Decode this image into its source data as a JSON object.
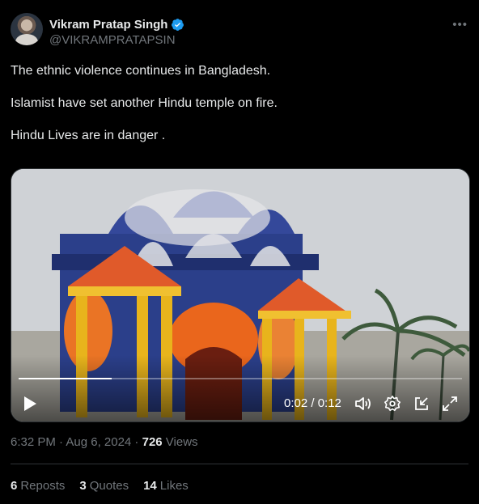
{
  "author": {
    "name": "Vikram Pratap Singh",
    "handle": "@VIKRAMPRATAPSIN",
    "verified": true
  },
  "more_icon": "ellipsis-icon",
  "post": {
    "lines": [
      "The ethnic violence continues in Bangladesh.",
      "Islamist have set another Hindu temple on fire.",
      "Hindu Lives are in danger ."
    ]
  },
  "video": {
    "time_display": "0:02 / 0:12",
    "progress": 0.21,
    "icons": [
      "play-icon",
      "volume-icon",
      "settings-icon",
      "picture-in-picture-icon",
      "fullscreen-icon"
    ]
  },
  "meta": {
    "timestamp": "6:32 PM · Aug 6, 2024 · ",
    "views_count": "726",
    "views_label": " Views"
  },
  "stats": {
    "reposts_count": "6",
    "reposts_label": "Reposts",
    "quotes_count": "3",
    "quotes_label": "Quotes",
    "likes_count": "14",
    "likes_label": "Likes"
  },
  "colors": {
    "background": "#000000",
    "text": "#e7e9ea",
    "muted": "#71767b",
    "verified": "#1d9bf0"
  }
}
